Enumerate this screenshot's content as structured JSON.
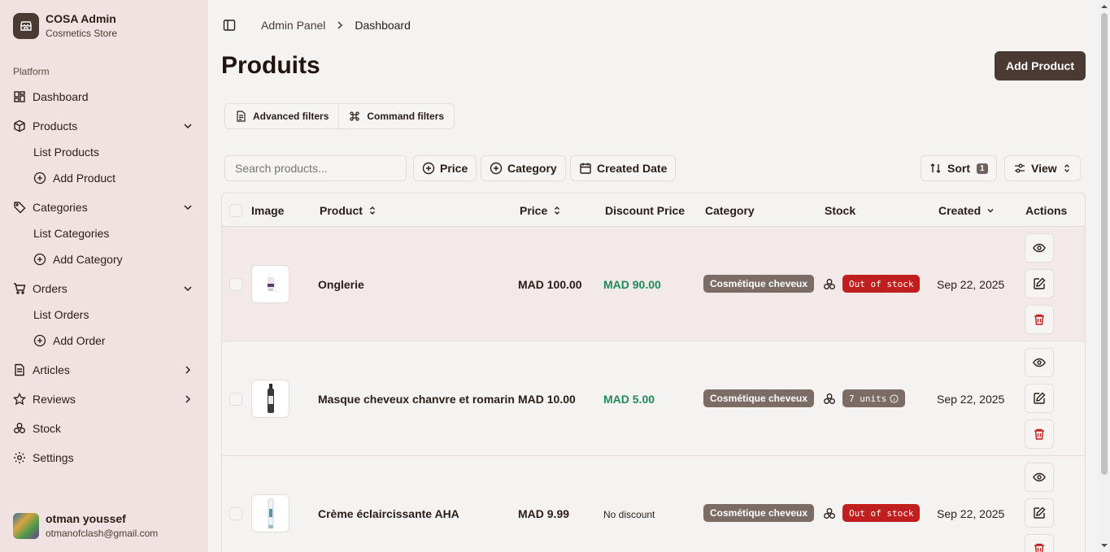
{
  "sidebar": {
    "brand_title": "COSA Admin",
    "brand_sub": "Cosmetics Store",
    "group_label": "Platform",
    "items": {
      "dashboard": "Dashboard",
      "products": "Products",
      "list_products": "List Products",
      "add_product": "Add Product",
      "categories": "Categories",
      "list_categories": "List Categories",
      "add_category": "Add Category",
      "orders": "Orders",
      "list_orders": "List Orders",
      "add_order": "Add Order",
      "articles": "Articles",
      "reviews": "Reviews",
      "stock": "Stock",
      "settings": "Settings"
    },
    "user_name": "otman youssef",
    "user_email": "otmanofclash@gmail.com"
  },
  "header": {
    "crumb_root": "Admin Panel",
    "crumb_current": "Dashboard",
    "title": "Produits",
    "add_button": "Add Product"
  },
  "filters": {
    "advanced": "Advanced filters",
    "command": "Command filters",
    "search_placeholder": "Search products...",
    "price": "Price",
    "category": "Category",
    "created_date": "Created Date",
    "sort": "Sort",
    "sort_count": "1",
    "view": "View"
  },
  "table": {
    "columns": {
      "image": "Image",
      "product": "Product",
      "price": "Price",
      "discount": "Discount Price",
      "category": "Category",
      "stock": "Stock",
      "created": "Created",
      "actions": "Actions"
    },
    "rows": [
      {
        "product": "Onglerie",
        "price": "MAD 100.00",
        "discount": "MAD 90.00",
        "category": "Cosmétique cheveux",
        "stock": "Out of stock",
        "created": "Sep 22, 2025"
      },
      {
        "product": "Masque cheveux chanvre et romarin",
        "price": "MAD 10.00",
        "discount": "MAD 5.00",
        "category": "Cosmétique cheveux",
        "stock": "7 units",
        "created": "Sep 22, 2025"
      },
      {
        "product": "Crème éclaircissante AHA",
        "price": "MAD 9.99",
        "discount": "No discount",
        "category": "Cosmétique cheveux",
        "stock": "Out of stock",
        "created": "Sep 22, 2025"
      }
    ]
  },
  "colors": {
    "accent": "#4a3a33",
    "sidebar_bg": "#efe2e0",
    "danger": "#c01f1f",
    "discount": "#1f8a5a"
  }
}
